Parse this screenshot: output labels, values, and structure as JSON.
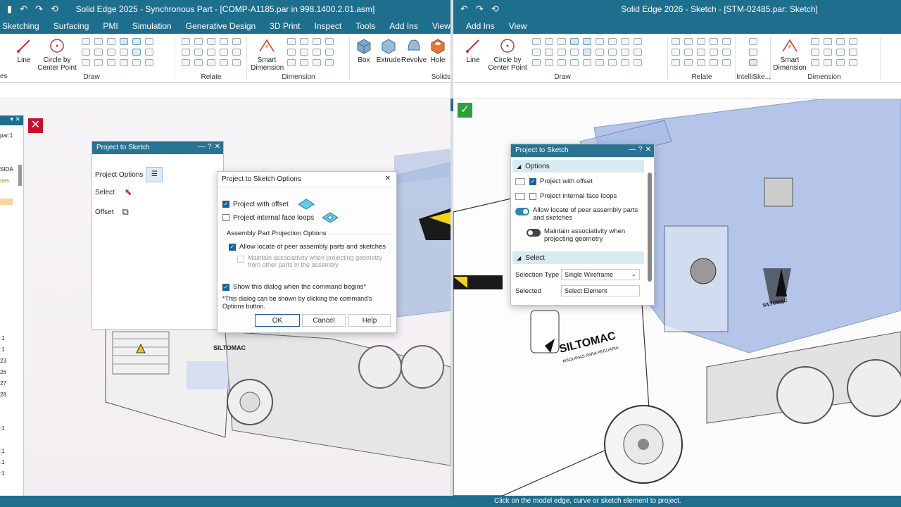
{
  "left": {
    "window_title": "Solid Edge 2025 - Synchronous Part - [COMP-A1185.par in 998.1400.2.01.asm]",
    "tabs": [
      "Sketching",
      "Surfacing",
      "PMI",
      "Simulation",
      "Generative Design",
      "3D Print",
      "Inspect",
      "Tools",
      "Add Ins",
      "View"
    ],
    "ribbon": {
      "line": "Line",
      "circle_l1": "Circle by",
      "circle_l2": "Center Point",
      "smart_l1": "Smart",
      "smart_l2": "Dimension",
      "box": "Box",
      "extrude": "Extrude",
      "revolve": "Revolve",
      "hole": "Hole",
      "groups": {
        "draw": "Draw",
        "relate": "Relate",
        "dimension": "Dimension",
        "solids": "Solids"
      },
      "side": "es"
    },
    "nav_items": [
      "par:1",
      "SIDA",
      "nes",
      ":1",
      ":1",
      "23",
      "26",
      "27",
      "28",
      ":1",
      ":1",
      ":1",
      ":1"
    ],
    "verdict_icon": "x-icon",
    "panel": {
      "title": "Project to Sketch",
      "project_options": "Project Options",
      "select": "Select",
      "offset": "Offset"
    },
    "options_dialog": {
      "title": "Project to Sketch Options",
      "project_with_offset": "Project with offset",
      "project_internal_face_loops": "Project internal face loops",
      "assembly_group": "Assembly Part Projection Options",
      "allow_locate": "Allow locate of peer assembly parts and sketches",
      "maintain_l1": "Maintain associativity when projecting geometry",
      "maintain_l2": "from other parts in the assembly",
      "show_dialog": "Show this dialog when the command begins*",
      "note_l1": "*This dialog can be shown by clicking the command's",
      "note_l2": "Options button.",
      "ok": "OK",
      "cancel": "Cancel",
      "help": "Help",
      "checked": {
        "project_with_offset": true,
        "project_internal_face_loops": false,
        "allow_locate": true,
        "maintain": false,
        "show_dialog": true
      }
    },
    "truck_text": "SILTOMAC"
  },
  "right": {
    "window_title": "Solid Edge 2026 - Sketch - [STM-02485.par: Sketch]",
    "tabs": [
      "Add Ins",
      "View"
    ],
    "ribbon": {
      "line": "Line",
      "circle_l1": "Circle by",
      "circle_l2": "Center Point",
      "smart_l1": "Smart",
      "smart_l2": "Dimension",
      "groups": {
        "draw": "Draw",
        "relate": "Relate",
        "intellisketch": "IntelliSke...",
        "dimension": "Dimension"
      }
    },
    "verdict_icon": "checkmark-icon",
    "panel": {
      "title": "Project to Sketch",
      "options_section": "Options",
      "project_with_offset": "Project with offset",
      "project_internal_face_loops": "Project internal face loops",
      "allow_l1": "Allow locate of peer assembly parts",
      "allow_l2": "and sketches",
      "maintain_l1": "Maintain associativity when",
      "maintain_l2": "projecting geometry",
      "select_section": "Select",
      "selection_type_label": "Selection Type",
      "selection_type_value": "Single Wireframe",
      "selected_label": "Selected",
      "selected_value": "Select Element",
      "checked": {
        "project_with_offset": true,
        "project_internal_face_loops": false,
        "allow_locate": true,
        "maintain": false
      }
    },
    "truck_text": "SILTOMAC",
    "truck_sub": "MÁQUINAS PARA PECUÁRIA"
  },
  "status_text": "Click on the model edge, curve or sketch element to project.",
  "colors": {
    "accent": "#1e6e8e",
    "wrong": "#c8102e",
    "right": "#2e9e3e"
  }
}
